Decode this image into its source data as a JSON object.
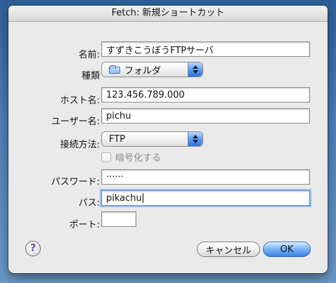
{
  "window": {
    "title": "Fetch: 新規ショートカット"
  },
  "form": {
    "name_label": "名前:",
    "name_value": "すずきこうぼうFTPサーバ",
    "type_label": "種類",
    "type_value": "フォルダ",
    "host_label": "ホスト名:",
    "host_value": "123.456.789.000",
    "user_label": "ユーザー名:",
    "user_value": "pichu",
    "method_label": "接続方法:",
    "method_value": "FTP",
    "encrypt_label": "暗号化する",
    "password_label": "パスワード:",
    "password_value": "······",
    "path_label": "パス:",
    "path_value": "pikachu",
    "port_label": "ポート:",
    "port_value": ""
  },
  "buttons": {
    "help": "?",
    "cancel": "キャンセル",
    "ok": "OK"
  },
  "colors": {
    "desktop_blue": "#4f7fb8",
    "primary_button_blue": "#3a83e0",
    "focus_ring_blue": "#5a8ed8"
  },
  "icons": {
    "type_popup_icon": "folder-icon",
    "popup_arrows": "up-down-arrow-icon"
  }
}
